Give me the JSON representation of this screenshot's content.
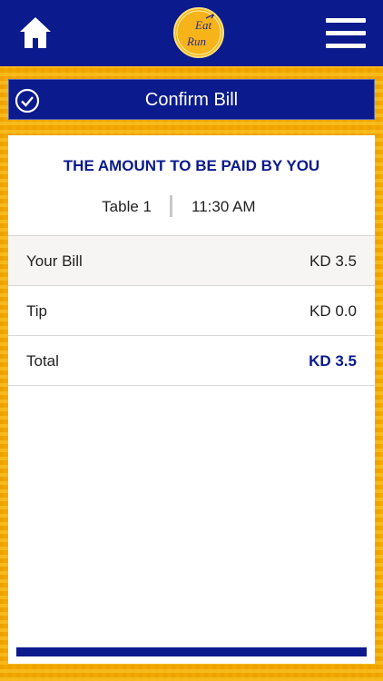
{
  "header": {
    "home_icon": "home-icon",
    "logo_text_1": "Eat",
    "logo_text_2": "Run",
    "menu_icon": "hamburger-menu-icon"
  },
  "titlebar": {
    "icon": "check-circle-icon",
    "title": "Confirm Bill"
  },
  "card": {
    "heading": "THE AMOUNT TO BE PAID BY YOU",
    "table": "Table 1",
    "time": "11:30 AM",
    "rows": [
      {
        "label": "Your Bill",
        "value": "KD 3.5"
      },
      {
        "label": "Tip",
        "value": "KD 0.0"
      },
      {
        "label": "Total",
        "value": "KD 3.5"
      }
    ]
  },
  "colors": {
    "navy": "#0b1a8c",
    "gold": "#f2a800",
    "white": "#ffffff"
  }
}
